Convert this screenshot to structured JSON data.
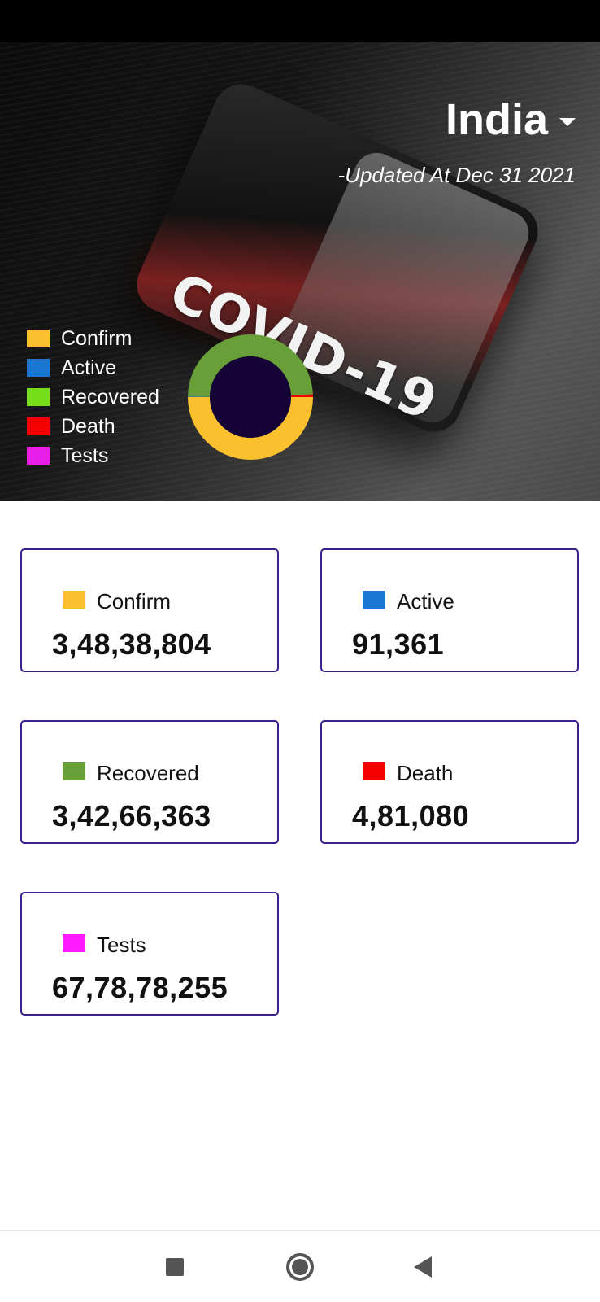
{
  "header": {
    "country": "India",
    "updated": "-Updated At Dec 31 2021"
  },
  "hero": {
    "image_text": "COVID-19"
  },
  "legend": [
    {
      "label": "Confirm",
      "color": "#fbc02d"
    },
    {
      "label": "Active",
      "color": "#1976d2"
    },
    {
      "label": "Recovered",
      "color": "#76dd1b"
    },
    {
      "label": "Death",
      "color": "#f40000"
    },
    {
      "label": "Tests",
      "color": "#e91ee9"
    }
  ],
  "chart_data": {
    "type": "pie",
    "slices": [
      {
        "label": "Confirm",
        "value": 34838804,
        "color": "#fbc02d"
      },
      {
        "label": "Active",
        "value": 91361,
        "color": "#1976d2"
      },
      {
        "label": "Recovered",
        "value": 34266363,
        "color": "#689f38"
      },
      {
        "label": "Death",
        "value": 481080,
        "color": "#f40000"
      }
    ]
  },
  "cards": [
    {
      "label": "Confirm",
      "value": "3,48,38,804",
      "color": "#fbc02d"
    },
    {
      "label": "Active",
      "value": "91,361",
      "color": "#1976d2"
    },
    {
      "label": "Recovered",
      "value": "3,42,66,363",
      "color": "#689f38"
    },
    {
      "label": "Death",
      "value": "4,81,080",
      "color": "#f40000"
    },
    {
      "label": "Tests",
      "value": "67,78,78,255",
      "color": "#ff1aff"
    }
  ],
  "nav": {
    "recents_icon": "square-icon",
    "home_icon": "circle-icon",
    "back_icon": "triangle-back-icon"
  }
}
